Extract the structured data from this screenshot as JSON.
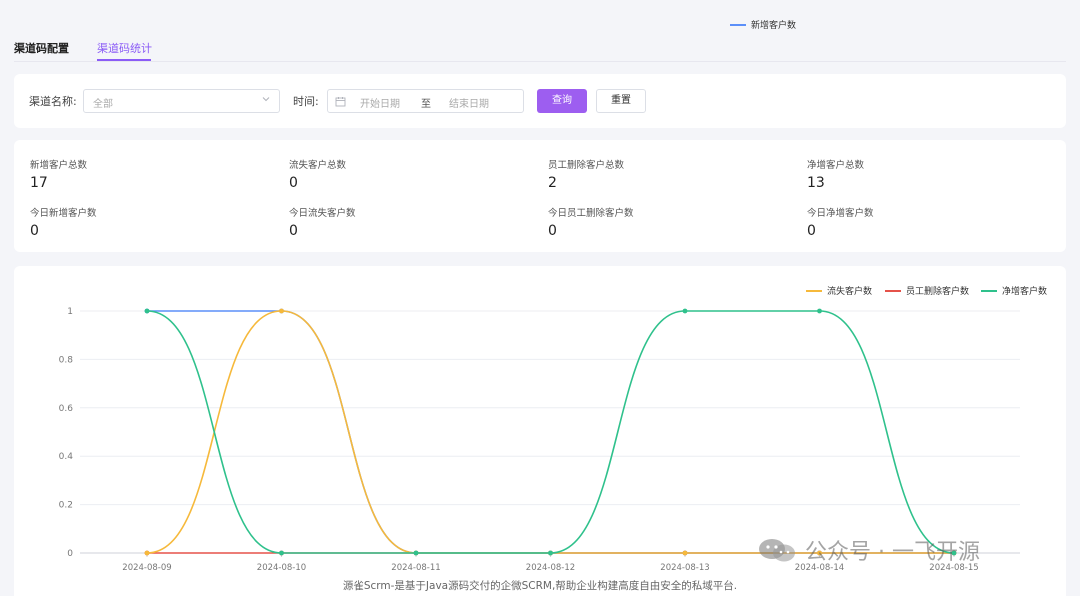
{
  "tabs": [
    {
      "label": "渠道码配置",
      "active": false
    },
    {
      "label": "渠道码统计",
      "active": true
    }
  ],
  "filter": {
    "channel_label": "渠道名称:",
    "channel_value": "全部",
    "time_label": "时间:",
    "start_placeholder": "开始日期",
    "range_separator": "至",
    "end_placeholder": "结束日期",
    "query_button": "查询",
    "reset_button": "重置"
  },
  "stats": [
    {
      "label": "新增客户总数",
      "value": "17"
    },
    {
      "label": "流失客户总数",
      "value": "0"
    },
    {
      "label": "员工删除客户总数",
      "value": "2"
    },
    {
      "label": "净增客户总数",
      "value": "13"
    },
    {
      "label": "今日新增客户数",
      "value": "0"
    },
    {
      "label": "今日流失客户数",
      "value": "0"
    },
    {
      "label": "今日员工删除客户数",
      "value": "0"
    },
    {
      "label": "今日净增客户数",
      "value": "0"
    }
  ],
  "chart_data": {
    "type": "line",
    "smooth": true,
    "categories": [
      "2024-08-09",
      "2024-08-10",
      "2024-08-11",
      "2024-08-12",
      "2024-08-13",
      "2024-08-14",
      "2024-08-15"
    ],
    "ylim": [
      0,
      1
    ],
    "yticks": [
      "0",
      "0.2",
      "0.4",
      "0.6",
      "0.8",
      "1"
    ],
    "grid": true,
    "legend_position": "top-right",
    "series": [
      {
        "name": "新增客户数",
        "color": "#5b8ff9",
        "values": [
          1,
          1,
          0,
          0,
          0,
          0,
          0
        ]
      },
      {
        "name": "流失客户数",
        "color": "#f6b93b",
        "values": [
          0,
          1,
          0,
          0,
          0,
          0,
          0
        ]
      },
      {
        "name": "员工删除客户数",
        "color": "#e5524a",
        "values": [
          0,
          0,
          0,
          0,
          0,
          0,
          0
        ]
      },
      {
        "name": "净增客户数",
        "color": "#2fc18c",
        "values": [
          1,
          0,
          0,
          0,
          1,
          1,
          0
        ]
      }
    ]
  },
  "watermark": "公众号 · 一飞开源",
  "caption": "源雀Scrm-是基于Java源码交付的企微SCRM,帮助企业构建高度自由安全的私域平台."
}
